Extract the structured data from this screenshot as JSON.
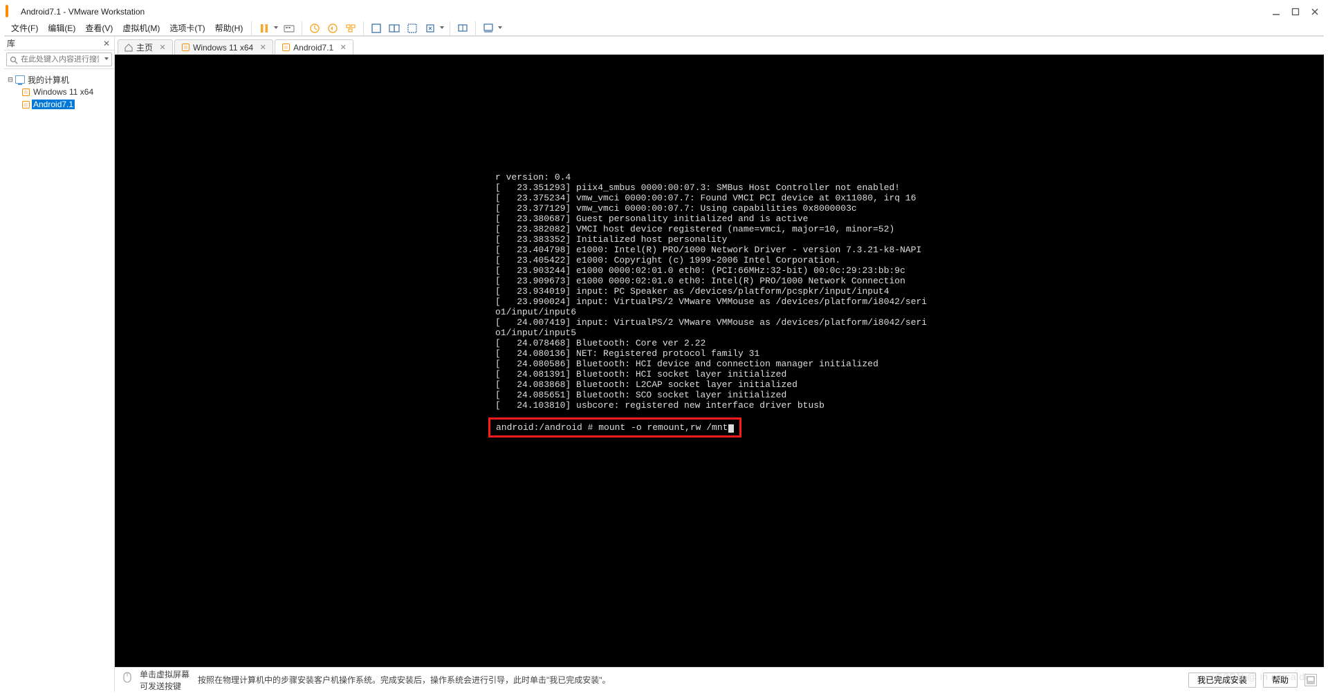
{
  "window": {
    "title": "Android7.1 - VMware Workstation"
  },
  "menus": {
    "file": "文件(F)",
    "edit": "编辑(E)",
    "view": "查看(V)",
    "vm": "虚拟机(M)",
    "tabs": "选项卡(T)",
    "help": "帮助(H)"
  },
  "library": {
    "header": "库",
    "search_placeholder": "在此处键入内容进行搜索",
    "root": "我的计算机",
    "items": [
      {
        "label": "Windows 11 x64",
        "selected": false
      },
      {
        "label": "Android7.1",
        "selected": true
      }
    ]
  },
  "tabs": [
    {
      "label": "主页",
      "kind": "home",
      "closable": true,
      "active": false
    },
    {
      "label": "Windows 11 x64",
      "kind": "vm",
      "closable": true,
      "active": false
    },
    {
      "label": "Android7.1",
      "kind": "vm",
      "closable": true,
      "active": true
    }
  ],
  "console": {
    "lines": [
      "r version: 0.4",
      "[   23.351293] piix4_smbus 0000:00:07.3: SMBus Host Controller not enabled!",
      "[   23.375234] vmw_vmci 0000:00:07.7: Found VMCI PCI device at 0x11080, irq 16",
      "[   23.377129] vmw_vmci 0000:00:07.7: Using capabilities 0x8000003c",
      "[   23.380687] Guest personality initialized and is active",
      "[   23.382082] VMCI host device registered (name=vmci, major=10, minor=52)",
      "[   23.383352] Initialized host personality",
      "[   23.404798] e1000: Intel(R) PRO/1000 Network Driver - version 7.3.21-k8-NAPI",
      "[   23.405422] e1000: Copyright (c) 1999-2006 Intel Corporation.",
      "[   23.903244] e1000 0000:02:01.0 eth0: (PCI:66MHz:32-bit) 00:0c:29:23:bb:9c",
      "[   23.909673] e1000 0000:02:01.0 eth0: Intel(R) PRO/1000 Network Connection",
      "[   23.934019] input: PC Speaker as /devices/platform/pcspkr/input/input4",
      "[   23.990024] input: VirtualPS/2 VMware VMMouse as /devices/platform/i8042/seri",
      "o1/input/input6",
      "[   24.007419] input: VirtualPS/2 VMware VMMouse as /devices/platform/i8042/seri",
      "o1/input/input5",
      "[   24.078468] Bluetooth: Core ver 2.22",
      "[   24.080136] NET: Registered protocol family 31",
      "[   24.080586] Bluetooth: HCI device and connection manager initialized",
      "[   24.081391] Bluetooth: HCI socket layer initialized",
      "[   24.083868] Bluetooth: L2CAP socket layer initialized",
      "[   24.085651] Bluetooth: SCO socket layer initialized",
      "[   24.103810] usbcore: registered new interface driver btusb"
    ],
    "prompt": "android:/android # mount -o remount,rw /mnt"
  },
  "statusbar": {
    "hint_line1": "单击虚拟屏幕",
    "hint_line2": "可发送按键",
    "message": "按照在物理计算机中的步骤安装客户机操作系统。完成安装后，操作系统会进行引导，此时单击\"我已完成安装\"。",
    "btn_done": "我已完成安装",
    "btn_help": "帮助"
  },
  "watermark": "CSDN @ in cerca di"
}
